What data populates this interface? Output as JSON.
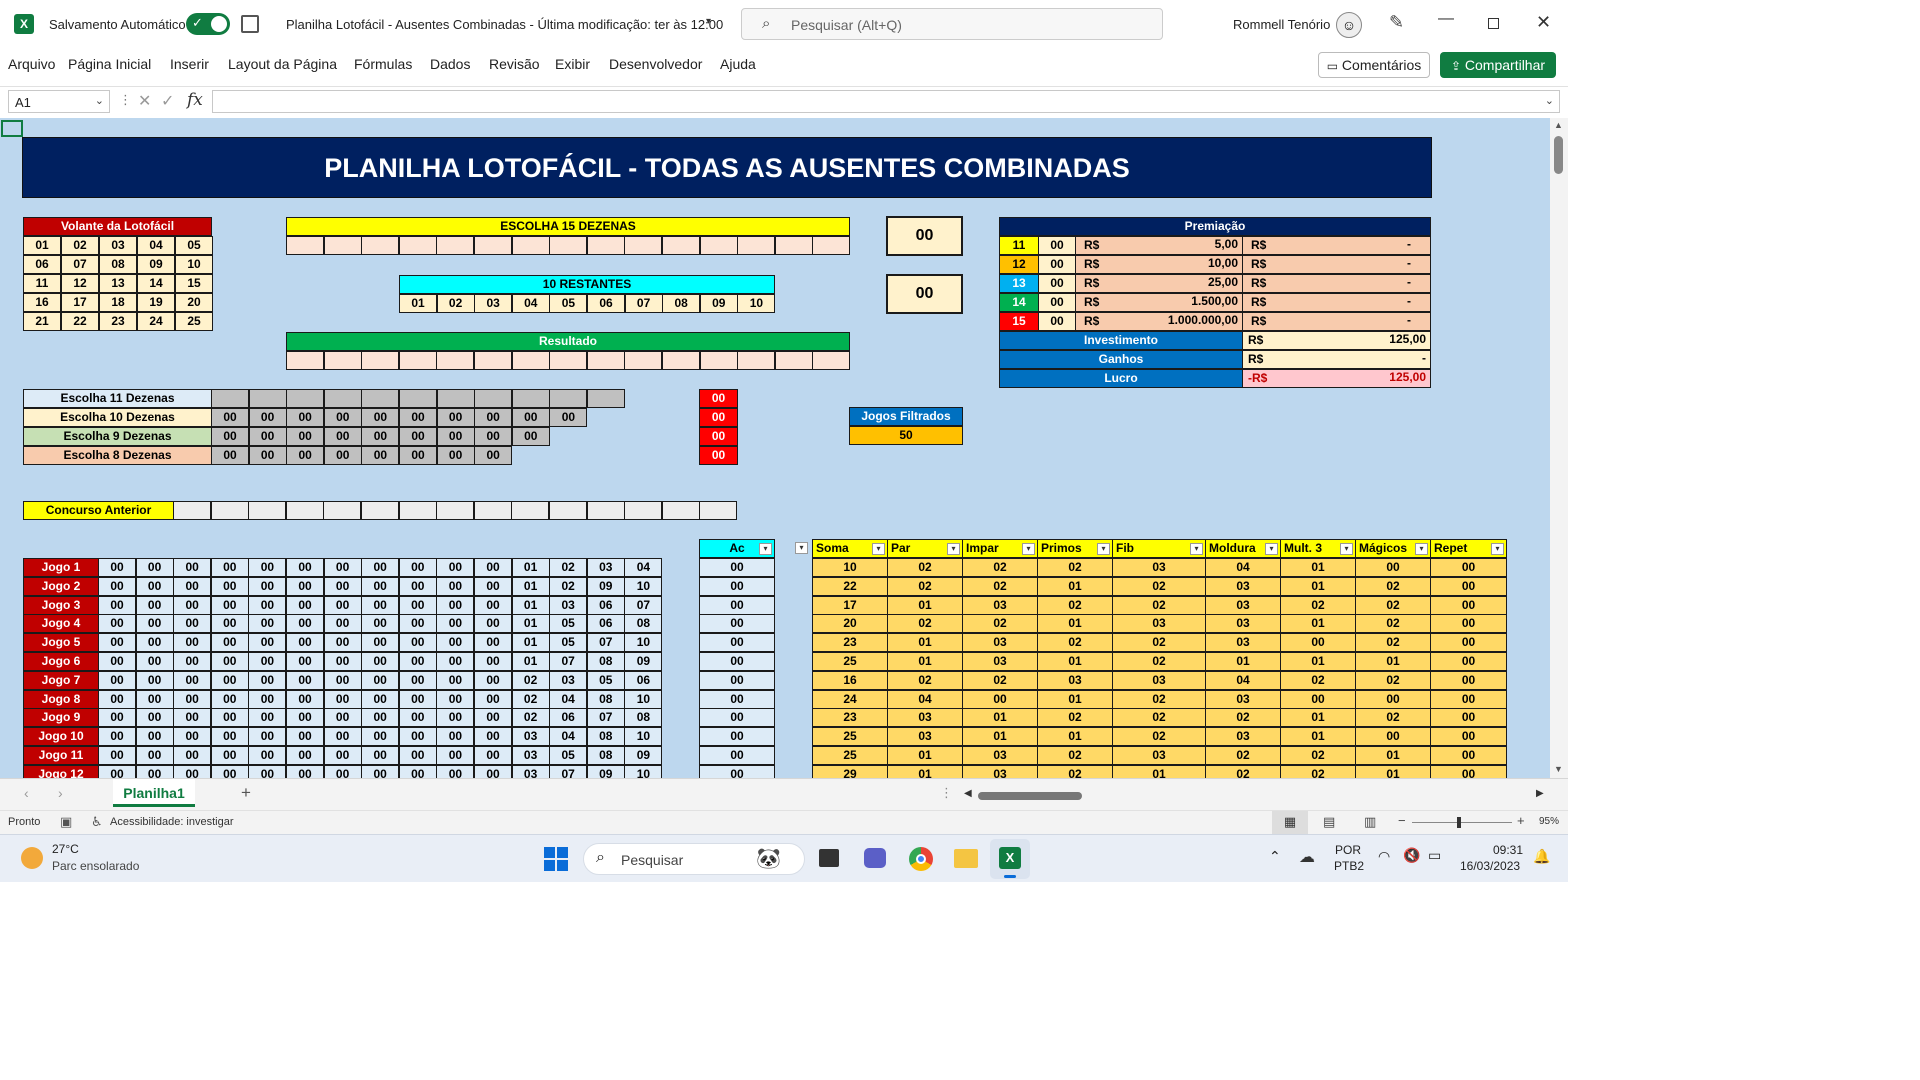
{
  "titlebar": {
    "autosave_label": "Salvamento Automático",
    "doc_title": "Planilha Lotofácil - Ausentes Combinadas  -  Última modificação: ter às 12:00",
    "search_placeholder": "Pesquisar (Alt+Q)",
    "user_name": "Rommell Tenório"
  },
  "ribbon": {
    "menu": [
      "Arquivo",
      "Página Inicial",
      "Inserir",
      "Layout da Página",
      "Fórmulas",
      "Dados",
      "Revisão",
      "Exibir",
      "Desenvolvedor",
      "Ajuda"
    ],
    "comments_label": "Comentários",
    "share_label": "Compartilhar"
  },
  "formula_bar": {
    "name_box": "A1",
    "formula": ""
  },
  "sheet": {
    "title": "PLANILHA LOTOFÁCIL - TODAS AS AUSENTES COMBINADAS",
    "volante": {
      "header": "Volante da Lotofácil",
      "rows": [
        [
          "01",
          "02",
          "03",
          "04",
          "05"
        ],
        [
          "06",
          "07",
          "08",
          "09",
          "10"
        ],
        [
          "11",
          "12",
          "13",
          "14",
          "15"
        ],
        [
          "16",
          "17",
          "18",
          "19",
          "20"
        ],
        [
          "21",
          "22",
          "23",
          "24",
          "25"
        ]
      ]
    },
    "escolha15_header": "ESCOLHA 15 DEZENAS",
    "restantes": {
      "header": "10 RESTANTES",
      "values": [
        "01",
        "02",
        "03",
        "04",
        "05",
        "06",
        "07",
        "08",
        "09",
        "10"
      ]
    },
    "resultado_header": "Resultado",
    "counter_a": "00",
    "counter_b": "00",
    "premiacao": {
      "header": "Premiação",
      "rows": [
        {
          "hits": "11",
          "count": "00",
          "cur": "R$",
          "prize": "5,00",
          "cur2": "R$",
          "total": "-",
          "color": "#ffff00",
          "fg": "#000"
        },
        {
          "hits": "12",
          "count": "00",
          "cur": "R$",
          "prize": "10,00",
          "cur2": "R$",
          "total": "-",
          "color": "#ffc000",
          "fg": "#000"
        },
        {
          "hits": "13",
          "count": "00",
          "cur": "R$",
          "prize": "25,00",
          "cur2": "R$",
          "total": "-",
          "color": "#00b0f0",
          "fg": "#fff"
        },
        {
          "hits": "14",
          "count": "00",
          "cur": "R$",
          "prize": "1.500,00",
          "cur2": "R$",
          "total": "-",
          "color": "#00b050",
          "fg": "#fff"
        },
        {
          "hits": "15",
          "count": "00",
          "cur": "R$",
          "prize": "1.000.000,00",
          "cur2": "R$",
          "total": "-",
          "color": "#ff0000",
          "fg": "#fff"
        }
      ],
      "investimento_label": "Investimento",
      "investimento_cur": "R$",
      "investimento_value": "125,00",
      "ganhos_label": "Ganhos",
      "ganhos_cur": "R$",
      "ganhos_value": "-",
      "lucro_label": "Lucro",
      "lucro_cur": "-R$",
      "lucro_value": "125,00"
    },
    "escolhas": [
      {
        "label": "Escolha 11 Dezenas",
        "values": [],
        "cells": 11,
        "count": "00",
        "color": "#ddebf7"
      },
      {
        "label": "Escolha 10 Dezenas",
        "values": [
          "00",
          "00",
          "00",
          "00",
          "00",
          "00",
          "00",
          "00",
          "00",
          "00"
        ],
        "cells": 10,
        "count": "00",
        "color": "#fff2cc"
      },
      {
        "label": "Escolha 9 Dezenas",
        "values": [
          "00",
          "00",
          "00",
          "00",
          "00",
          "00",
          "00",
          "00",
          "00"
        ],
        "cells": 9,
        "count": "00",
        "color": "#c6e0b4"
      },
      {
        "label": "Escolha 8 Dezenas",
        "values": [
          "00",
          "00",
          "00",
          "00",
          "00",
          "00",
          "00",
          "00"
        ],
        "cells": 8,
        "count": "00",
        "color": "#f8cbad"
      }
    ],
    "jogos_filtrados": {
      "label": "Jogos Filtrados",
      "value": "50"
    },
    "concurso_anterior_label": "Concurso Anterior",
    "ac_header": "Ac",
    "stats_headers": [
      "Soma",
      "Par",
      "Impar",
      "Primos",
      "Fib",
      "Moldura",
      "Mult. 3",
      "Mágicos",
      "Repet"
    ],
    "jogos": [
      {
        "label": "Jogo 1",
        "nums": [
          "00",
          "00",
          "00",
          "00",
          "00",
          "00",
          "00",
          "00",
          "00",
          "00",
          "00",
          "01",
          "02",
          "03",
          "04"
        ],
        "ac": "00",
        "stats": [
          "10",
          "02",
          "02",
          "02",
          "03",
          "04",
          "01",
          "00",
          "00"
        ]
      },
      {
        "label": "Jogo 2",
        "nums": [
          "00",
          "00",
          "00",
          "00",
          "00",
          "00",
          "00",
          "00",
          "00",
          "00",
          "00",
          "01",
          "02",
          "09",
          "10"
        ],
        "ac": "00",
        "stats": [
          "22",
          "02",
          "02",
          "01",
          "02",
          "03",
          "01",
          "02",
          "00"
        ]
      },
      {
        "label": "Jogo 3",
        "nums": [
          "00",
          "00",
          "00",
          "00",
          "00",
          "00",
          "00",
          "00",
          "00",
          "00",
          "00",
          "01",
          "03",
          "06",
          "07"
        ],
        "ac": "00",
        "stats": [
          "17",
          "01",
          "03",
          "02",
          "02",
          "03",
          "02",
          "02",
          "00"
        ]
      },
      {
        "label": "Jogo 4",
        "nums": [
          "00",
          "00",
          "00",
          "00",
          "00",
          "00",
          "00",
          "00",
          "00",
          "00",
          "00",
          "01",
          "05",
          "06",
          "08"
        ],
        "ac": "00",
        "stats": [
          "20",
          "02",
          "02",
          "01",
          "03",
          "03",
          "01",
          "02",
          "00"
        ]
      },
      {
        "label": "Jogo 5",
        "nums": [
          "00",
          "00",
          "00",
          "00",
          "00",
          "00",
          "00",
          "00",
          "00",
          "00",
          "00",
          "01",
          "05",
          "07",
          "10"
        ],
        "ac": "00",
        "stats": [
          "23",
          "01",
          "03",
          "02",
          "02",
          "03",
          "00",
          "02",
          "00"
        ]
      },
      {
        "label": "Jogo 6",
        "nums": [
          "00",
          "00",
          "00",
          "00",
          "00",
          "00",
          "00",
          "00",
          "00",
          "00",
          "00",
          "01",
          "07",
          "08",
          "09"
        ],
        "ac": "00",
        "stats": [
          "25",
          "01",
          "03",
          "01",
          "02",
          "01",
          "01",
          "01",
          "00"
        ]
      },
      {
        "label": "Jogo 7",
        "nums": [
          "00",
          "00",
          "00",
          "00",
          "00",
          "00",
          "00",
          "00",
          "00",
          "00",
          "00",
          "02",
          "03",
          "05",
          "06"
        ],
        "ac": "00",
        "stats": [
          "16",
          "02",
          "02",
          "03",
          "03",
          "04",
          "02",
          "02",
          "00"
        ]
      },
      {
        "label": "Jogo 8",
        "nums": [
          "00",
          "00",
          "00",
          "00",
          "00",
          "00",
          "00",
          "00",
          "00",
          "00",
          "00",
          "02",
          "04",
          "08",
          "10"
        ],
        "ac": "00",
        "stats": [
          "24",
          "04",
          "00",
          "01",
          "02",
          "03",
          "00",
          "00",
          "00"
        ]
      },
      {
        "label": "Jogo 9",
        "nums": [
          "00",
          "00",
          "00",
          "00",
          "00",
          "00",
          "00",
          "00",
          "00",
          "00",
          "00",
          "02",
          "06",
          "07",
          "08"
        ],
        "ac": "00",
        "stats": [
          "23",
          "03",
          "01",
          "02",
          "02",
          "02",
          "01",
          "02",
          "00"
        ]
      },
      {
        "label": "Jogo 10",
        "nums": [
          "00",
          "00",
          "00",
          "00",
          "00",
          "00",
          "00",
          "00",
          "00",
          "00",
          "00",
          "03",
          "04",
          "08",
          "10"
        ],
        "ac": "00",
        "stats": [
          "25",
          "03",
          "01",
          "01",
          "02",
          "03",
          "01",
          "00",
          "00"
        ]
      },
      {
        "label": "Jogo 11",
        "nums": [
          "00",
          "00",
          "00",
          "00",
          "00",
          "00",
          "00",
          "00",
          "00",
          "00",
          "00",
          "03",
          "05",
          "08",
          "09"
        ],
        "ac": "00",
        "stats": [
          "25",
          "01",
          "03",
          "02",
          "03",
          "02",
          "02",
          "01",
          "00"
        ]
      },
      {
        "label": "Jogo 12",
        "nums": [
          "00",
          "00",
          "00",
          "00",
          "00",
          "00",
          "00",
          "00",
          "00",
          "00",
          "00",
          "03",
          "07",
          "09",
          "10"
        ],
        "ac": "00",
        "stats": [
          "29",
          "01",
          "03",
          "02",
          "01",
          "02",
          "02",
          "01",
          "00"
        ]
      }
    ]
  },
  "sheettabs": {
    "active": "Planilha1"
  },
  "statusbar": {
    "ready": "Pronto",
    "accessibility": "Acessibilidade: investigar",
    "zoom": "95%"
  },
  "taskbar": {
    "weather_temp": "27°C",
    "weather_desc": "Parc ensolarado",
    "search_label": "Pesquisar",
    "lang_1": "POR",
    "lang_2": "PTB2",
    "time": "09:31",
    "date": "16/03/2023"
  },
  "colors": {
    "excel_green": "#107c41",
    "title_navy": "#002060",
    "volante_red": "#c00000",
    "yellow": "#ffff00",
    "cyan": "#00ffff",
    "green": "#00b050",
    "stats_yellow": "#ffd966"
  }
}
